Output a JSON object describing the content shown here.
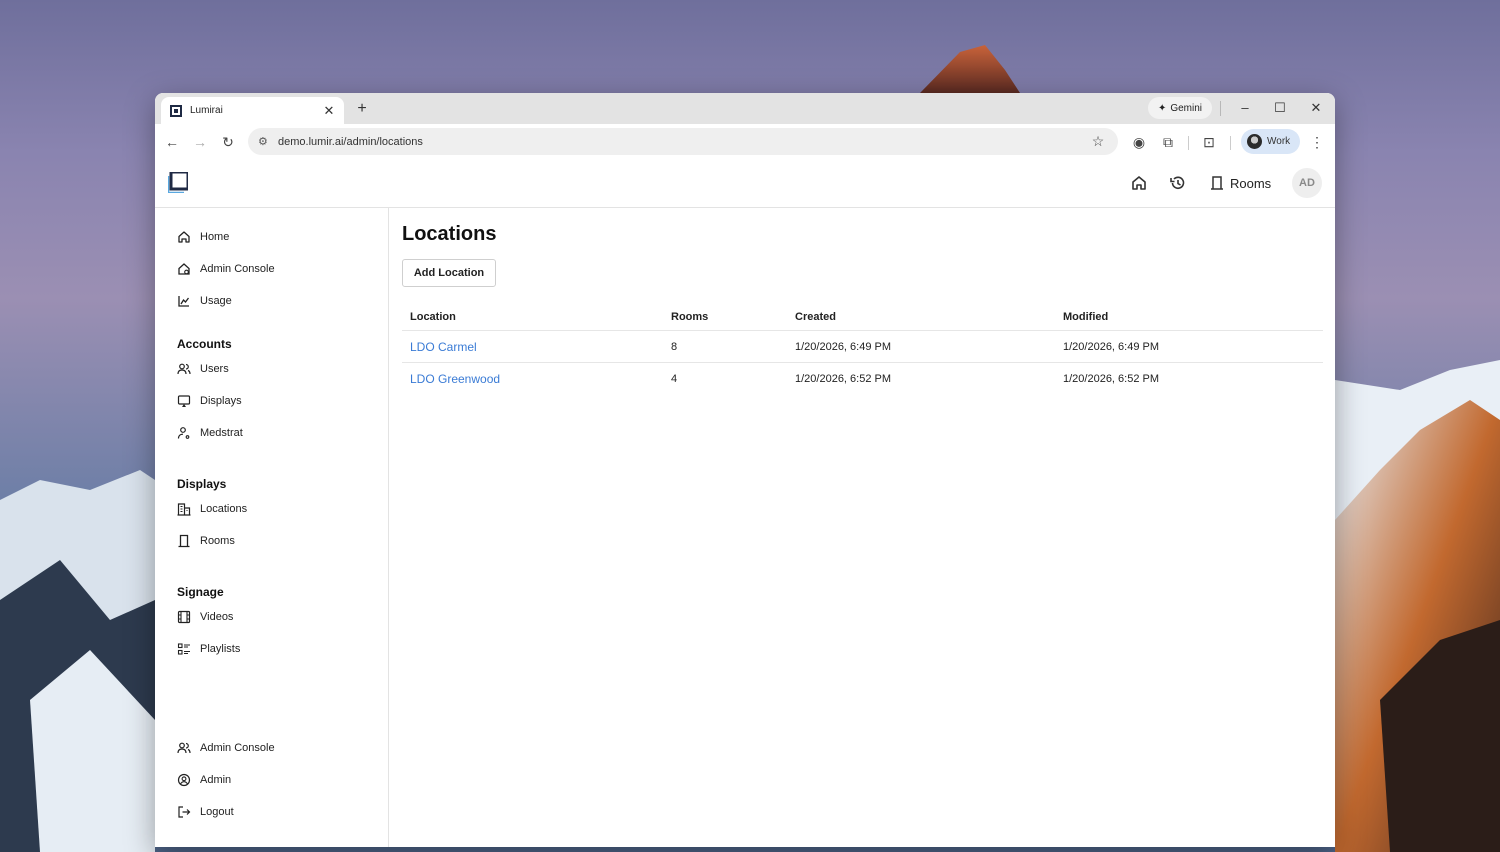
{
  "browser": {
    "tab_title": "Lumirai",
    "url": "demo.lumir.ai/admin/locations",
    "gemini_label": "Gemini",
    "profile_label": "Work"
  },
  "header": {
    "rooms_label": "Rooms",
    "avatar_initials": "AD"
  },
  "sidebar": {
    "top_items": [
      {
        "label": "Home",
        "icon": "home-icon"
      },
      {
        "label": "Admin Console",
        "icon": "admin-home-icon"
      },
      {
        "label": "Usage",
        "icon": "chart-icon"
      }
    ],
    "sections": [
      {
        "title": "Accounts",
        "items": [
          {
            "label": "Users",
            "icon": "users-icon"
          },
          {
            "label": "Displays",
            "icon": "display-icon"
          },
          {
            "label": "Medstrat",
            "icon": "user-key-icon"
          }
        ]
      },
      {
        "title": "Displays",
        "items": [
          {
            "label": "Locations",
            "icon": "building-icon"
          },
          {
            "label": "Rooms",
            "icon": "door-icon"
          }
        ]
      },
      {
        "title": "Signage",
        "items": [
          {
            "label": "Videos",
            "icon": "film-icon"
          },
          {
            "label": "Playlists",
            "icon": "playlist-icon"
          }
        ]
      }
    ],
    "bottom_items": [
      {
        "label": "Admin Console",
        "icon": "users-icon"
      },
      {
        "label": "Admin",
        "icon": "account-circle-icon"
      },
      {
        "label": "Logout",
        "icon": "logout-icon"
      }
    ]
  },
  "main": {
    "title": "Locations",
    "add_button": "Add Location",
    "table": {
      "headers": [
        "Location",
        "Rooms",
        "Created",
        "Modified"
      ],
      "rows": [
        {
          "location": "LDO Carmel",
          "rooms": "8",
          "created": "1/20/2026, 6:49 PM",
          "modified": "1/20/2026, 6:49 PM"
        },
        {
          "location": "LDO Greenwood",
          "rooms": "4",
          "created": "1/20/2026, 6:52 PM",
          "modified": "1/20/2026, 6:52 PM"
        }
      ]
    }
  },
  "colors": {
    "link": "#3a7bd5",
    "logo_dark": "#1f2a44",
    "logo_accent": "#5aa8e0"
  }
}
